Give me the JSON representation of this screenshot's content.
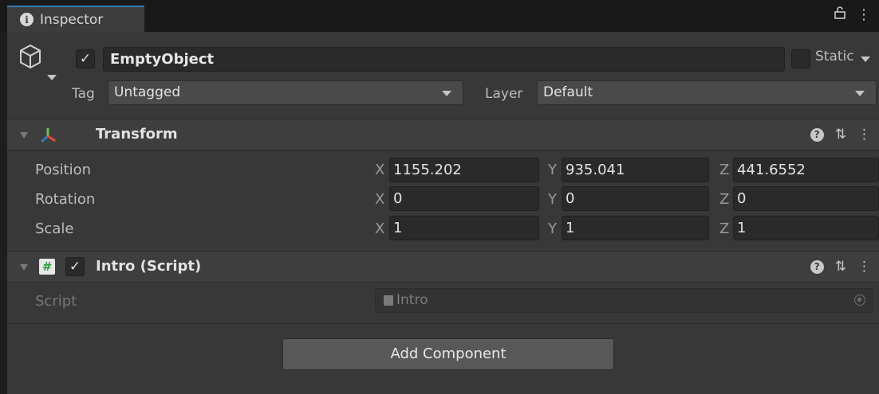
{
  "tab": {
    "title": "Inspector"
  },
  "gameobject": {
    "active": true,
    "name": "EmptyObject",
    "static_label": "Static",
    "tag_label": "Tag",
    "tag_value": "Untagged",
    "layer_label": "Layer",
    "layer_value": "Default"
  },
  "transform": {
    "title": "Transform",
    "rows": [
      {
        "label": "Position",
        "x": "1155.202",
        "y": "935.041",
        "z": "441.6552"
      },
      {
        "label": "Rotation",
        "x": "0",
        "y": "0",
        "z": "0"
      },
      {
        "label": "Scale",
        "x": "1",
        "y": "1",
        "z": "1"
      }
    ],
    "axes": {
      "x": "X",
      "y": "Y",
      "z": "Z"
    }
  },
  "script_component": {
    "enabled": true,
    "title": "Intro (Script)",
    "field_label": "Script",
    "field_value": "Intro"
  },
  "add_component_label": "Add Component",
  "colors": {
    "accent": "#3a79bb",
    "panel": "#383838",
    "header": "#3e3e3e"
  }
}
